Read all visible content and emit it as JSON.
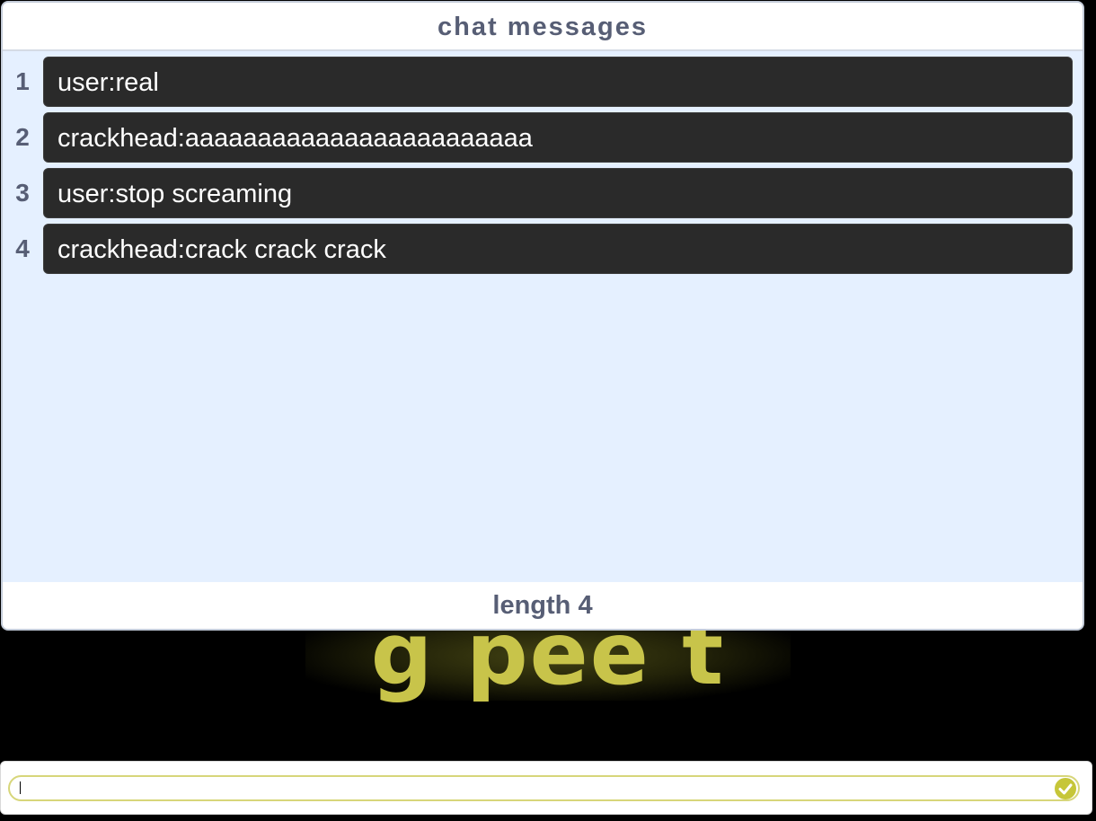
{
  "list": {
    "title": "chat messages",
    "items": [
      {
        "index": "1",
        "value": "user:real"
      },
      {
        "index": "2",
        "value": "crackhead:aaaaaaaaaaaaaaaaaaaaaaaa"
      },
      {
        "index": "3",
        "value": "user:stop screaming"
      },
      {
        "index": "4",
        "value": "crackhead:crack crack crack"
      }
    ],
    "footer": "length 4"
  },
  "background": {
    "banner_text": "g pee t"
  },
  "ask": {
    "value": "",
    "submit_icon": "check-icon"
  },
  "colors": {
    "list_background": "#e5f0ff",
    "item_background": "#2a2a2a",
    "header_text": "#575e75",
    "ask_accent": "#c6c639",
    "banner_text": "#c8c44a"
  }
}
